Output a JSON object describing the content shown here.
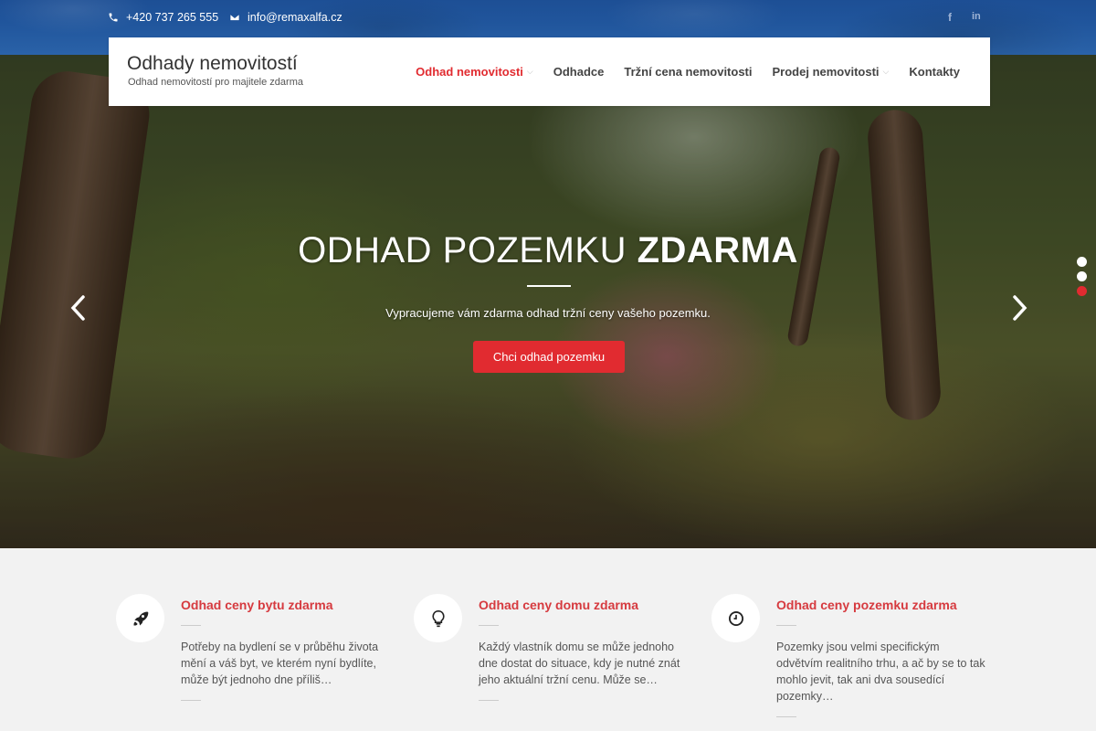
{
  "topbar": {
    "phone": "+420 737 265 555",
    "email": "info@remaxalfa.cz",
    "social": [
      {
        "icon": "facebook-icon",
        "label": "f"
      },
      {
        "icon": "linkedin-icon",
        "label": "in"
      }
    ]
  },
  "brand": {
    "title": "Odhady nemovitostí",
    "subtitle": "Odhad nemovitostí pro majitele zdarma"
  },
  "nav": {
    "items": [
      {
        "label": "Odhad nemovitosti",
        "active": true,
        "has_dropdown": true
      },
      {
        "label": "Odhadce",
        "active": false,
        "has_dropdown": false
      },
      {
        "label": "Tržní cena nemovitosti",
        "active": false,
        "has_dropdown": false
      },
      {
        "label": "Prodej nemovitosti",
        "active": false,
        "has_dropdown": true
      },
      {
        "label": "Kontakty",
        "active": false,
        "has_dropdown": false
      }
    ],
    "active_color": "#e12b30"
  },
  "hero": {
    "title_light": "ODHAD POZEMKU",
    "title_bold": "ZDARMA",
    "text": "Vypracujeme vám zdarma odhad tržní ceny vašeho pozemku.",
    "button": "Chci odhad pozemku",
    "slides_total": 3,
    "active_slide": 3,
    "accent": "#e12b30"
  },
  "features": [
    {
      "icon": "rocket-icon",
      "title": "Odhad ceny bytu zdarma",
      "text": "Potřeby na bydlení se v průběhu života mění a váš byt, ve kterém nyní bydlíte, může být jednoho dne příliš…"
    },
    {
      "icon": "lightbulb-icon",
      "title": "Odhad ceny domu zdarma",
      "text": "Každý vlastník domu se může jednoho dne dostat do situace, kdy je nutné znát jeho aktuální tržní cenu. Může se…"
    },
    {
      "icon": "clock-icon",
      "title": "Odhad ceny pozemku zdarma",
      "text": "Pozemky jsou velmi specifickým odvětvím realitního trhu, a ač by se to tak mohlo jevit, tak ani dva sousedící pozemky…"
    }
  ]
}
